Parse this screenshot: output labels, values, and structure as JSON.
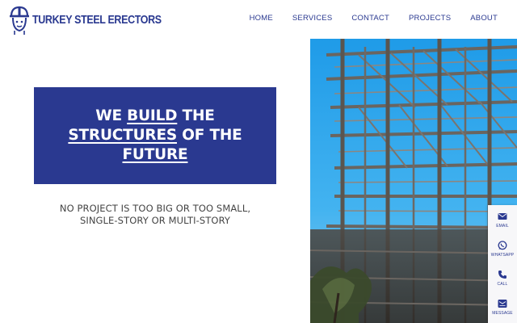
{
  "brand": {
    "name": "TURKEY STEEL ERECTORS",
    "color": "#2a3990"
  },
  "nav": {
    "items": [
      "HOME",
      "SERVICES",
      "CONTACT",
      "PROJECTS",
      "ABOUT"
    ]
  },
  "hero": {
    "line1_a": "WE ",
    "line1_u": "BUILD",
    "line1_b": " THE",
    "line2_u": "STRUCTURES",
    "line2_b": " OF THE",
    "line3_u": "FUTURE",
    "tagline_1": "NO PROJECT IS TOO BIG OR TOO SMALL,",
    "tagline_2": "SINGLE-STORY OR MULTI-STORY"
  },
  "contact_bar": {
    "items": [
      {
        "label": "EMAIL",
        "icon": "envelope-icon"
      },
      {
        "label": "WHATSAPP",
        "icon": "whatsapp-icon"
      },
      {
        "label": "CALL",
        "icon": "phone-icon"
      },
      {
        "label": "MESSAGE",
        "icon": "message-icon"
      }
    ]
  }
}
